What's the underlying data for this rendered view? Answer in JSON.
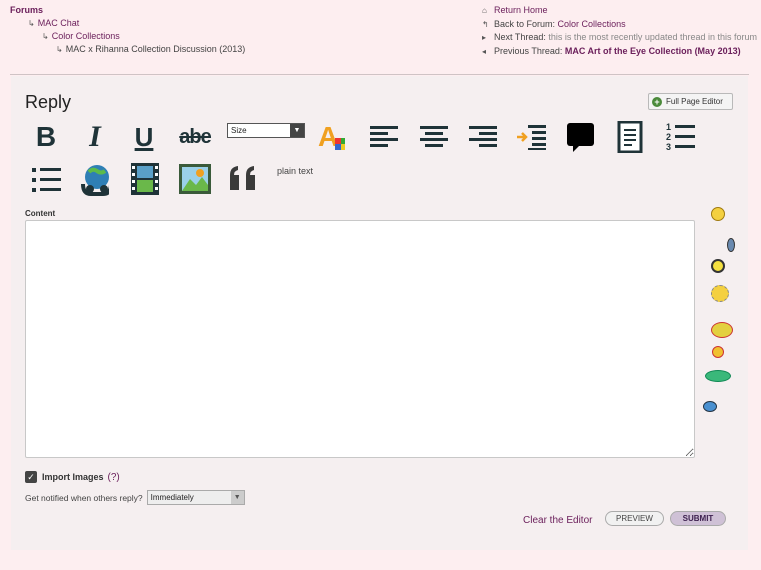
{
  "breadcrumb": {
    "root": "Forums",
    "level1": "MAC Chat",
    "level2": "Color Collections",
    "level3": "MAC x Rihanna Collection Discussion (2013)"
  },
  "thread_nav": {
    "return_home": "Return Home",
    "back_label": "Back to Forum:",
    "back_link": "Color Collections",
    "next_label": "Next Thread:",
    "next_value": "this is the most recently updated thread in this forum",
    "prev_label": "Previous Thread:",
    "prev_link": "MAC Art of the Eye Collection (May 2013)"
  },
  "reply": {
    "title": "Reply",
    "full_page_label": "Full Page Editor",
    "toolbar": {
      "bold": "B",
      "italic": "I",
      "underline": "U",
      "strike": "abe",
      "size_label": "Size",
      "plain_text": "plain text",
      "icons": [
        "bold-icon",
        "italic-icon",
        "underline-icon",
        "strikethrough-icon",
        "font-size-select",
        "font-color-icon",
        "align-left-icon",
        "align-center-icon",
        "align-right-icon",
        "indent-icon",
        "quote-bubble-icon",
        "document-icon",
        "numbered-list-icon",
        "bulleted-list-icon",
        "link-icon",
        "video-icon",
        "image-icon",
        "blockquote-icon"
      ]
    },
    "content_label": "Content",
    "editor_value": "",
    "import_images_label": "Import Images",
    "import_images_help": "(?)",
    "import_images_checked": true,
    "notify_label": "Get notified when others reply?",
    "notify_value": "Immediately",
    "clear_label": "Clear the Editor",
    "preview_label": "PREVIEW",
    "submit_label": "SUBMIT"
  },
  "colors": {
    "page_bg": "#fdeef0",
    "panel_bg": "#f5eff0",
    "link": "#6a1e5a",
    "toolbar_icon": "#1f3338",
    "submit_bg": "#cfc1d6"
  }
}
